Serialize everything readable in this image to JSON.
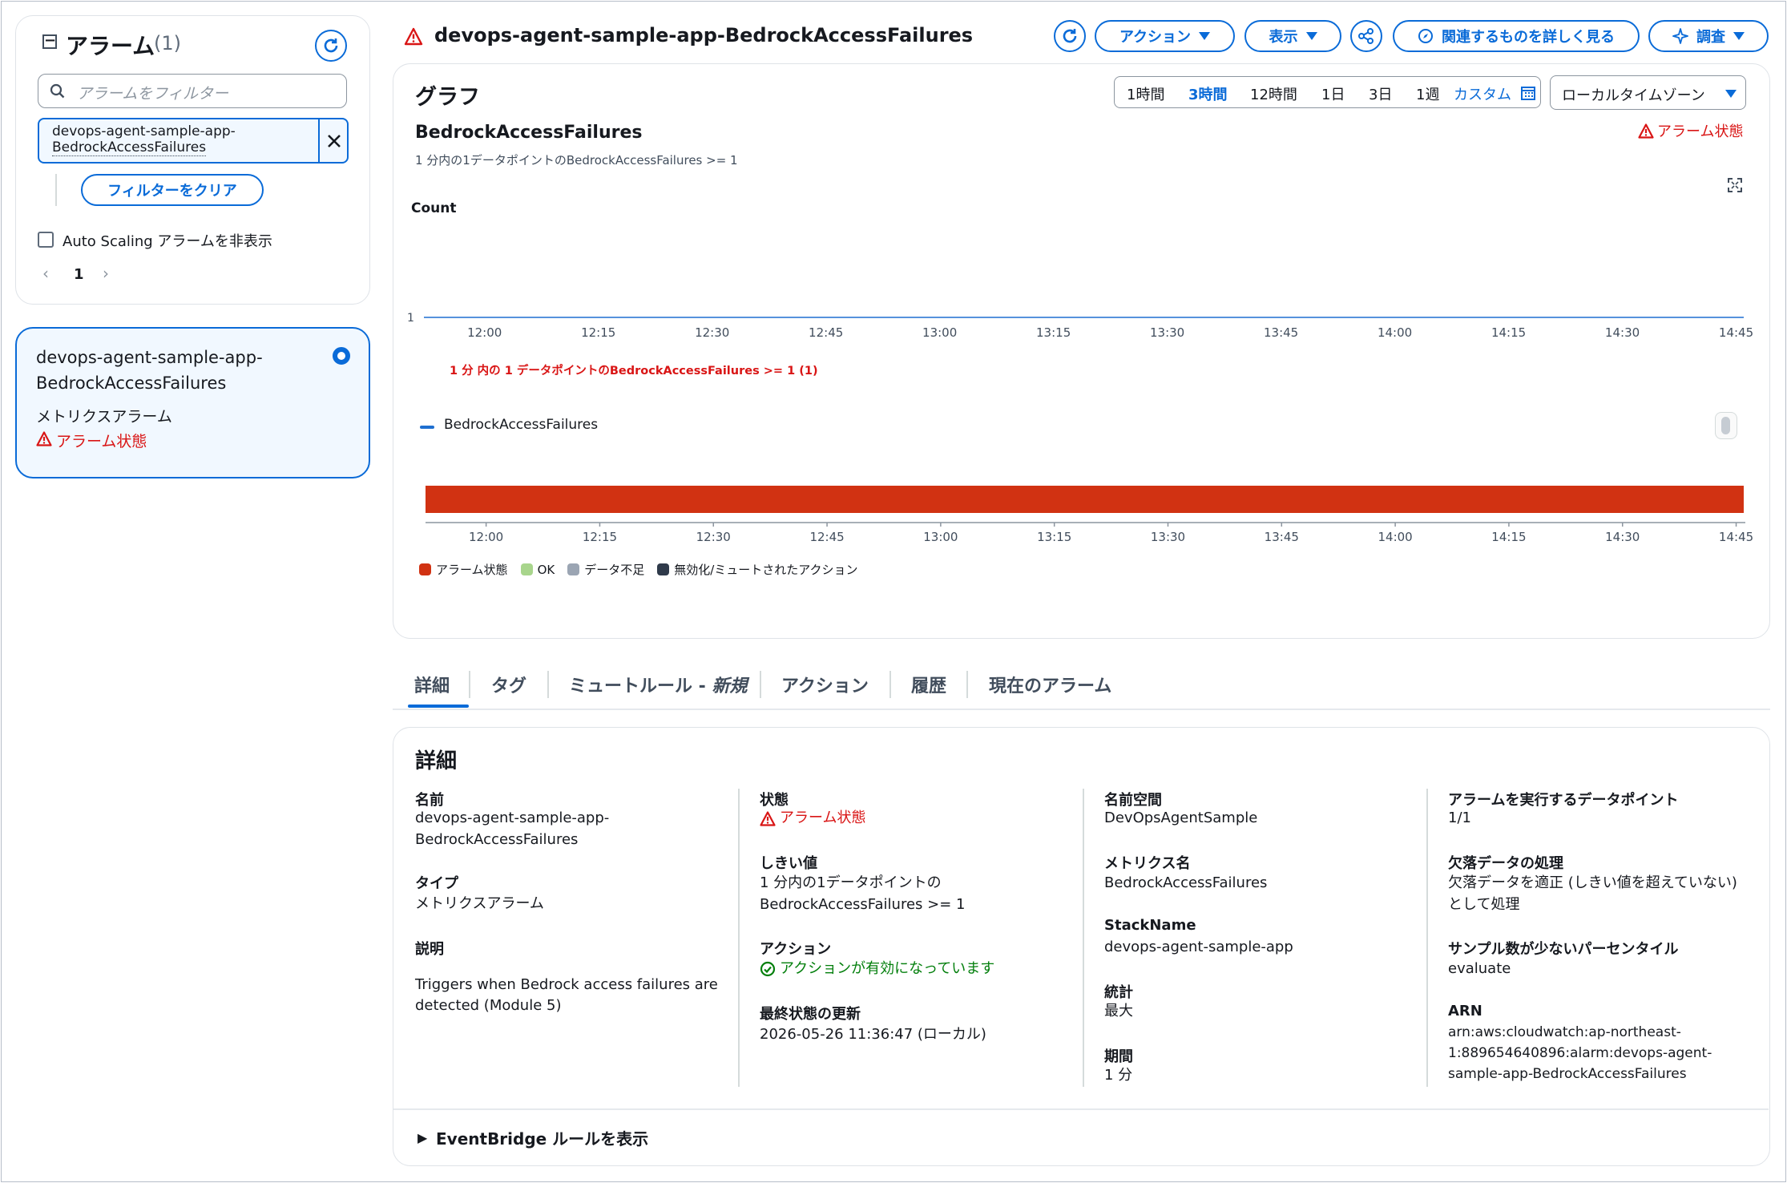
{
  "sidebar": {
    "title": "アラーム",
    "count": "(1)",
    "search_placeholder": "アラームをフィルター",
    "filter_token_line1": "devops-agent-sample-app-",
    "filter_token_line2": "BedrockAccessFailures",
    "clear_filter_label": "フィルターをクリア",
    "hide_autoscaling_label": "Auto Scaling アラームを非表示",
    "page_number": "1",
    "alarm_item": {
      "name_line1": "devops-agent-sample-app-",
      "name_line2": "BedrockAccessFailures",
      "type": "メトリクスアラーム",
      "state": "アラーム状態"
    }
  },
  "header": {
    "title": "devops-agent-sample-app-BedrockAccessFailures",
    "actions_label": "アクション",
    "view_label": "表示",
    "related_label": "関連するものを詳しく見る",
    "investigate_label": "調査"
  },
  "graph": {
    "section_title": "グラフ",
    "time_ranges": [
      "1時間",
      "3時間",
      "12時間",
      "1日",
      "3日",
      "1週"
    ],
    "selected_range": "3時間",
    "custom_label": "カスタム",
    "timezone_label": "ローカルタイムゾーン",
    "metric_title": "BedrockAccessFailures",
    "metric_subtitle": "1 分内の1データポイントのBedrockAccessFailures >= 1",
    "alarm_state_label": "アラーム状態",
    "colors": {
      "alarm": "#d13212",
      "ok": "#a8d58c",
      "insufficient": "#9ba5b3",
      "muted": "#2f3a4a",
      "series": "#1f6fd0",
      "threshold": "#d91515"
    }
  },
  "chart_data": {
    "type": "line",
    "ylabel": "Count",
    "yticks": [
      1
    ],
    "x_ticks": [
      "12:00",
      "12:15",
      "12:30",
      "12:45",
      "13:00",
      "13:15",
      "13:30",
      "13:45",
      "14:00",
      "14:15",
      "14:30",
      "14:45"
    ],
    "series": [
      {
        "name": "BedrockAccessFailures",
        "values": []
      }
    ],
    "threshold": {
      "value": 1,
      "label": "1 分 内の 1 データポイントのBedrockAccessFailures >= 1 (1)"
    },
    "state_timeline": {
      "x_ticks": [
        "12:00",
        "12:15",
        "12:30",
        "12:45",
        "13:00",
        "13:15",
        "13:30",
        "13:45",
        "14:00",
        "14:15",
        "14:30",
        "14:45"
      ],
      "segments": [
        {
          "state": "アラーム状態",
          "from": "11:52",
          "to": "14:46"
        }
      ],
      "legend": [
        "アラーム状態",
        "OK",
        "データ不足",
        "無効化/ミュートされたアクション"
      ]
    }
  },
  "tabs": [
    "詳細",
    "タグ",
    "ミュートルール - ",
    "新規",
    "アクション",
    "履歴",
    "現在のアラーム"
  ],
  "details": {
    "section_title": "詳細",
    "name_label": "名前",
    "name_value_line1": "devops-agent-sample-app-",
    "name_value_line2": "BedrockAccessFailures",
    "type_label": "タイプ",
    "type_value": "メトリクスアラーム",
    "description_label": "説明",
    "description_line1": "Triggers when Bedrock access failures are",
    "description_line2": "detected (Module 5)",
    "state_label": "状態",
    "state_value": "アラーム状態",
    "threshold_label": "しきい値",
    "threshold_line1": "1 分内の1データポイントの",
    "threshold_line2": "BedrockAccessFailures >= 1",
    "actions_label": "アクション",
    "actions_value": "アクションが有効になっています",
    "last_update_label": "最終状態の更新",
    "last_update_value": "2026-05-26 11:36:47 (ローカル)",
    "namespace_label": "名前空間",
    "namespace_value": "DevOpsAgentSample",
    "metric_name_label": "メトリクス名",
    "metric_name_value": "BedrockAccessFailures",
    "stackname_label": "StackName",
    "stackname_value": "devops-agent-sample-app",
    "statistic_label": "統計",
    "statistic_value": "最大",
    "period_label": "期間",
    "period_value": "1 分",
    "datapoints_label": "アラームを実行するデータポイント",
    "datapoints_value": "1/1",
    "missing_label": "欠落データの処理",
    "missing_line1": "欠落データを適正 (しきい値を超えていない)",
    "missing_line2": "として処理",
    "percentile_label": "サンプル数が少ないパーセンタイル",
    "percentile_value": "evaluate",
    "arn_label": "ARN",
    "arn_line1": "arn:aws:cloudwatch:ap-northeast-",
    "arn_line2": "1:889654640896:alarm:devops-agent-",
    "arn_line3": "sample-app-BedrockAccessFailures",
    "eventbridge_label": "EventBridge ルールを表示"
  }
}
